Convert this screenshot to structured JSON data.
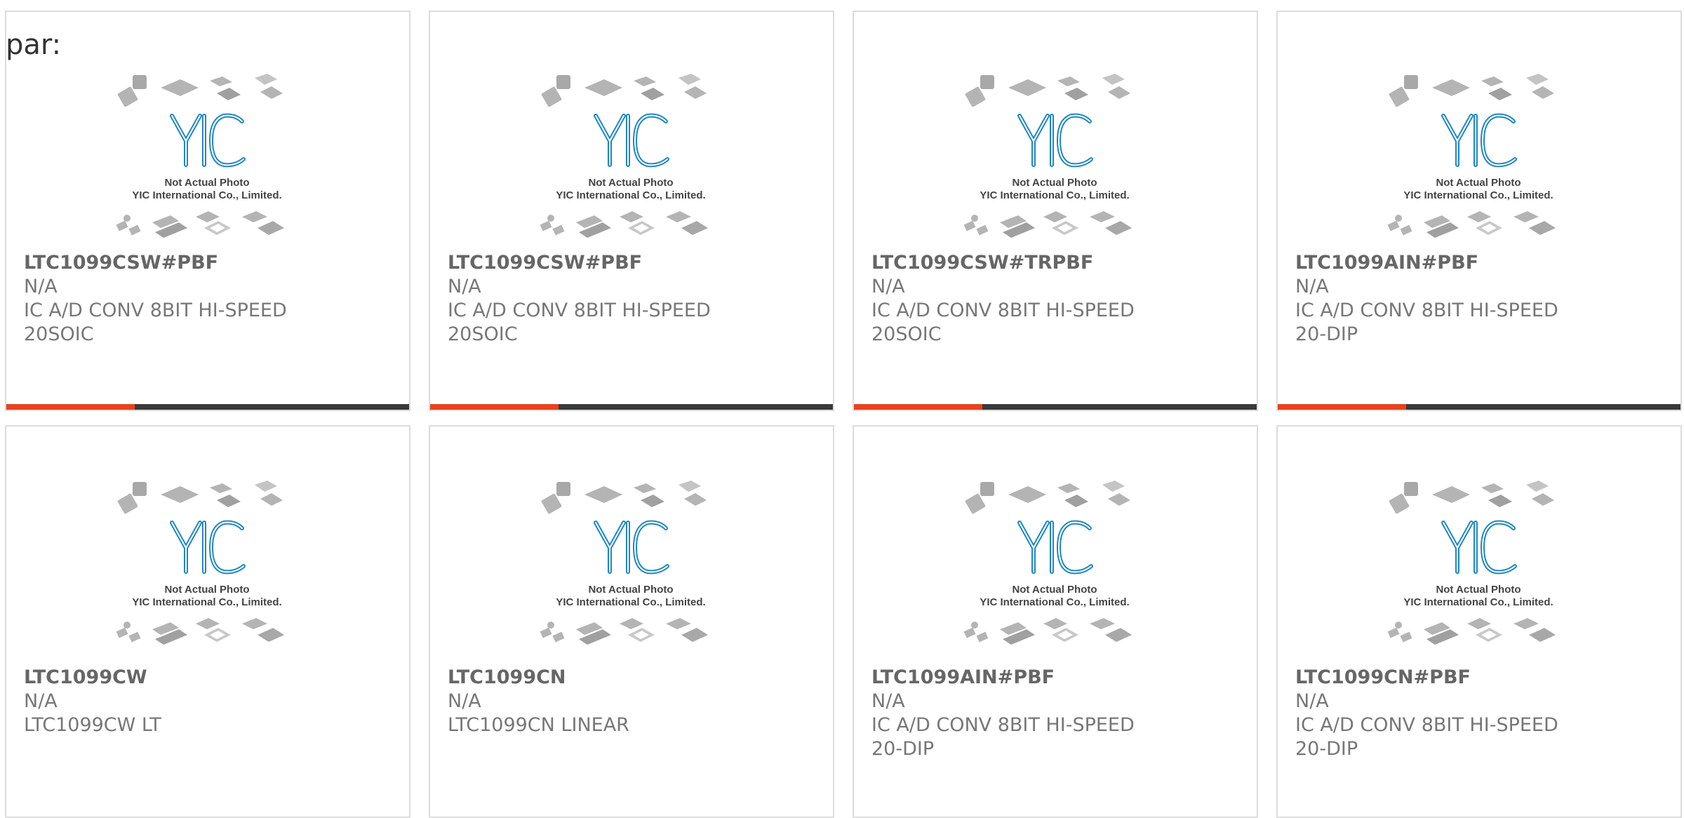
{
  "header": {
    "label": "par:"
  },
  "thumbnail": {
    "caption_line1": "Not Actual Photo",
    "caption_line2": "YIC International Co., Limited.",
    "logo_text": "YIC",
    "logo_color": "#1e87c8"
  },
  "colors": {
    "accent": "#e8421c",
    "bar": "#3a3a3a",
    "border": "#dcdcdc"
  },
  "products": [
    {
      "part": "LTC1099CSW#PBF",
      "mfr": "N/A",
      "desc": "IC A/D CONV 8BIT HI-SPEED 20SOIC",
      "bar": true
    },
    {
      "part": "LTC1099CSW#PBF",
      "mfr": "N/A",
      "desc": "IC A/D CONV 8BIT HI-SPEED 20SOIC",
      "bar": true
    },
    {
      "part": "LTC1099CSW#TRPBF",
      "mfr": "N/A",
      "desc": "IC A/D CONV 8BIT HI-SPEED 20SOIC",
      "bar": true
    },
    {
      "part": "LTC1099AIN#PBF",
      "mfr": "N/A",
      "desc": "IC A/D CONV 8BIT HI-SPEED 20-DIP",
      "bar": true
    },
    {
      "part": "LTC1099CW",
      "mfr": "N/A",
      "desc": "LTC1099CW LT",
      "bar": false
    },
    {
      "part": "LTC1099CN",
      "mfr": "N/A",
      "desc": "LTC1099CN LINEAR",
      "bar": false
    },
    {
      "part": "LTC1099AIN#PBF",
      "mfr": "N/A",
      "desc": "IC A/D CONV 8BIT HI-SPEED 20-DIP",
      "bar": false
    },
    {
      "part": "LTC1099CN#PBF",
      "mfr": "N/A",
      "desc": "IC A/D CONV 8BIT HI-SPEED 20-DIP",
      "bar": false
    }
  ]
}
